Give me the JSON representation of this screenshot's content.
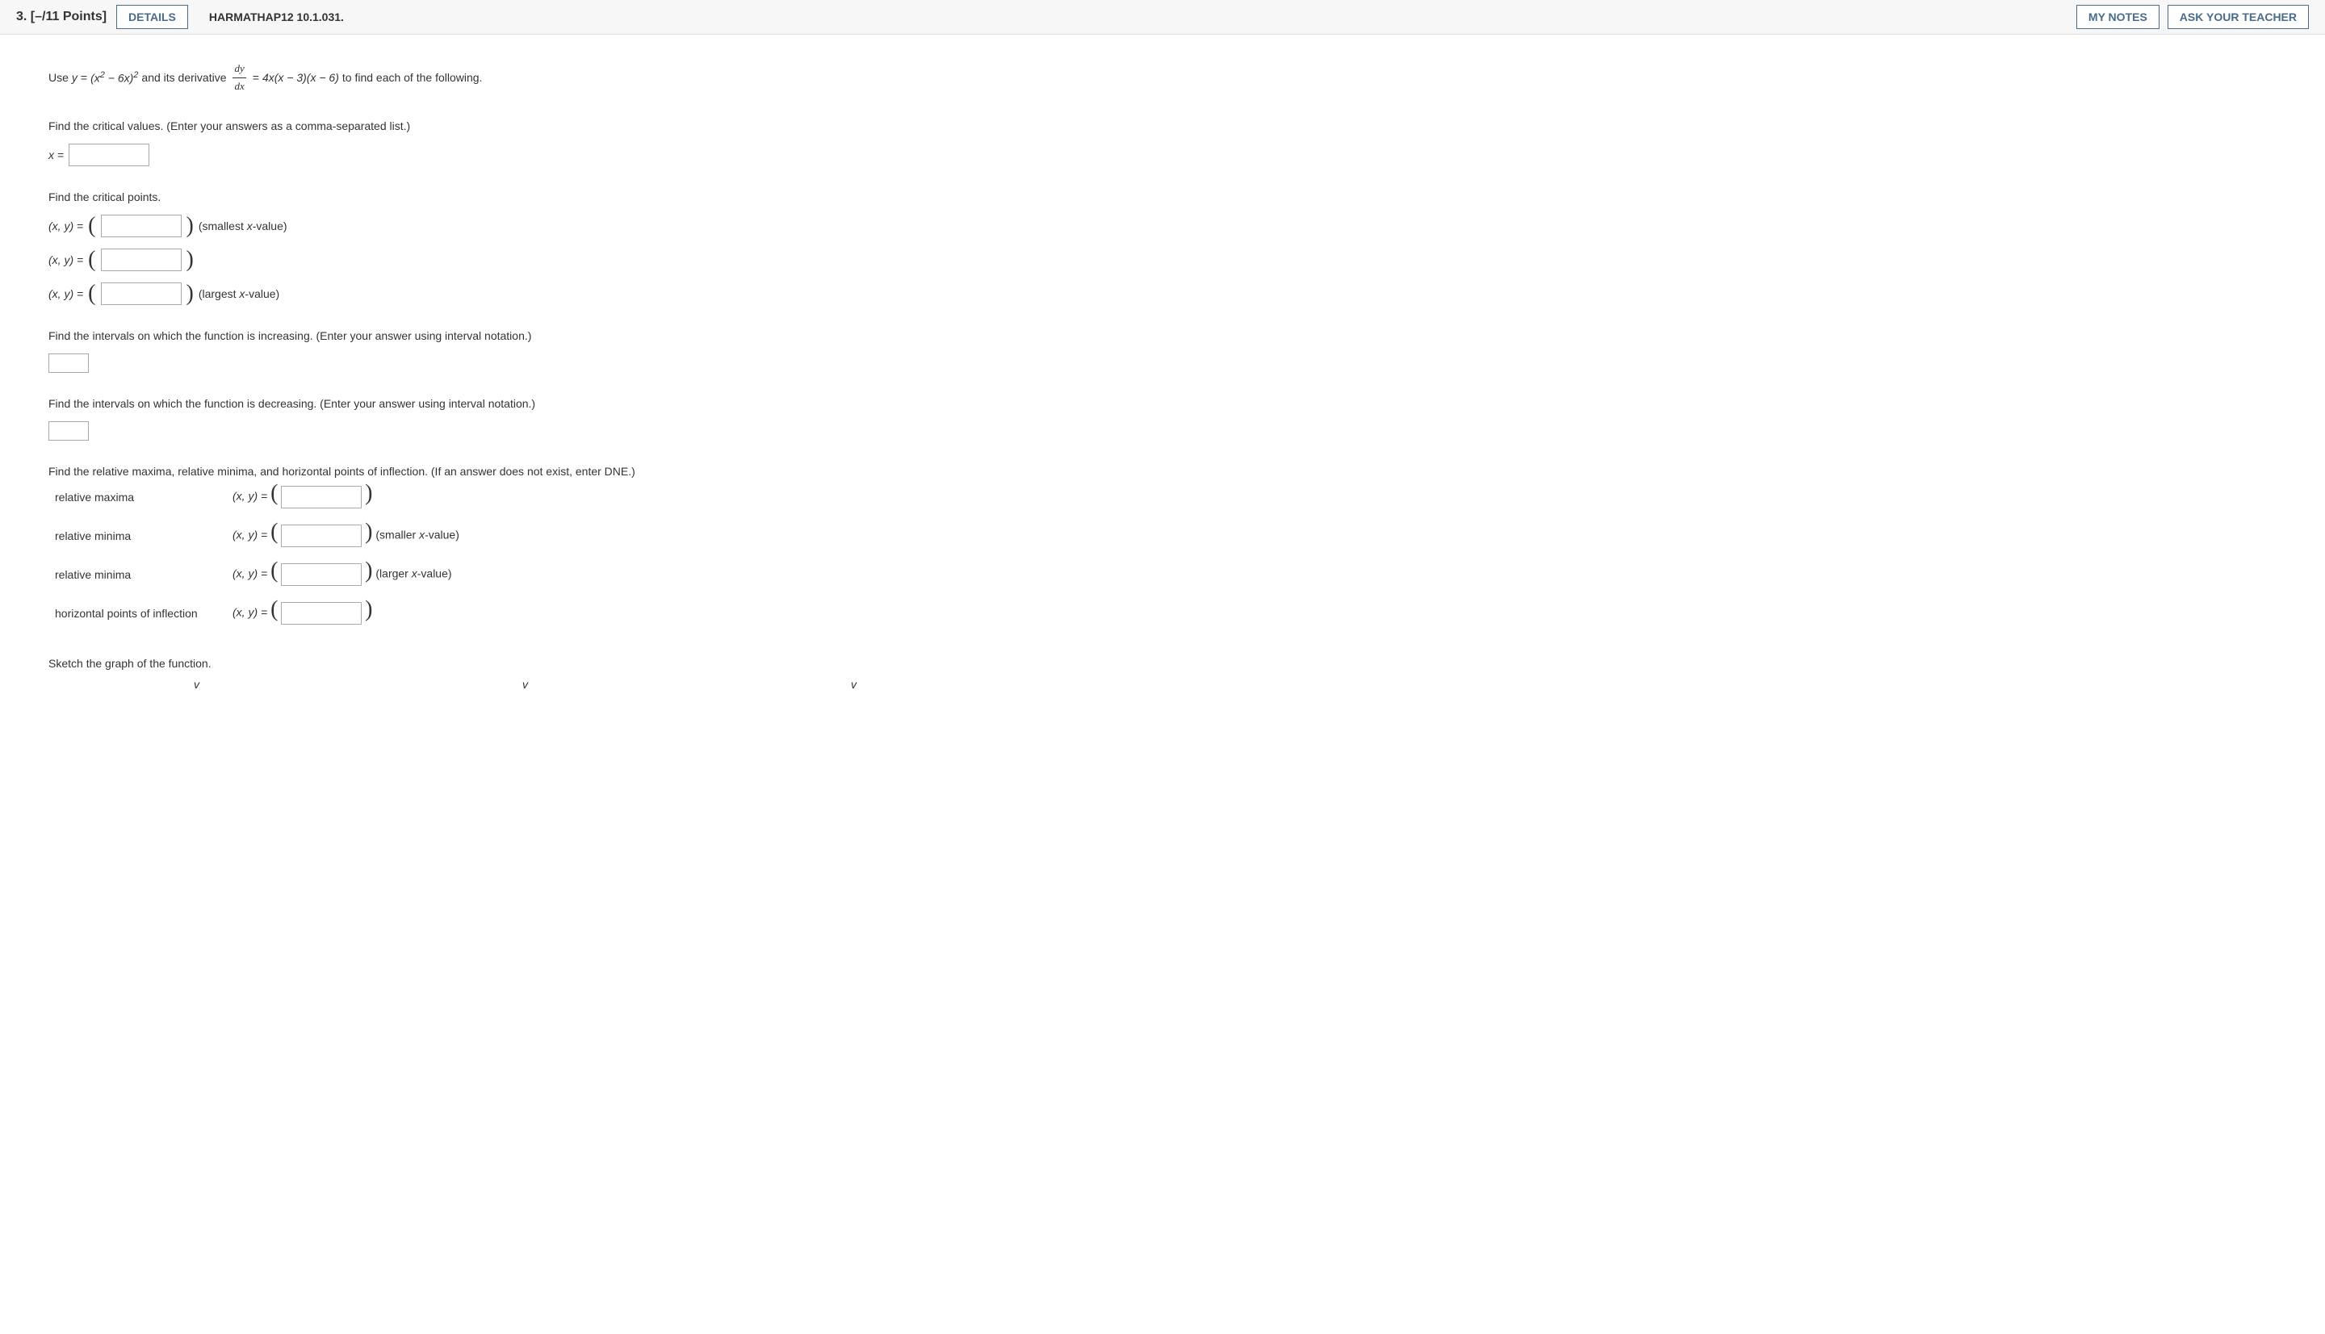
{
  "header": {
    "number": "3.",
    "points": "[–/11 Points]",
    "details_label": "DETAILS",
    "assignment_id": "HARMATHAP12 10.1.031.",
    "my_notes_label": "MY NOTES",
    "ask_teacher_label": "ASK YOUR TEACHER"
  },
  "prompt": {
    "use_text": "Use ",
    "y_eq": "y",
    "eq": " = ",
    "func": "(x",
    "sq": "2",
    "minus6x": " − 6x)",
    "and_deriv": " and its derivative ",
    "dy": "dy",
    "dx": "dx",
    "eq2": " = ",
    "deriv_expr": "4x(x − 3)(x − 6)",
    "to_find": " to find each of the following."
  },
  "sections": {
    "critical_values_label": "Find the critical values. (Enter your answers as a comma-separated list.)",
    "x_eq": "x =",
    "critical_points_label": "Find the critical points.",
    "xy_eq": "(x, y)  = ",
    "smallest_x": "(smallest x-value)",
    "largest_x": "(largest x-value)",
    "increasing_label": "Find the intervals on which the function is increasing. (Enter your answer using interval notation.)",
    "decreasing_label": "Find the intervals on which the function is decreasing. (Enter your answer using interval notation.)",
    "extrema_label": "Find the relative maxima, relative minima, and horizontal points of inflection. (If an answer does not exist, enter DNE.)",
    "rel_max": "relative maxima",
    "rel_min": "relative minima",
    "hpoi": "horizontal points of inflection",
    "xy2": "(x, y) = ",
    "smaller_x": "(smaller x-value)",
    "larger_x": "(larger x-value)",
    "sketch_label": "Sketch the graph of the function."
  }
}
